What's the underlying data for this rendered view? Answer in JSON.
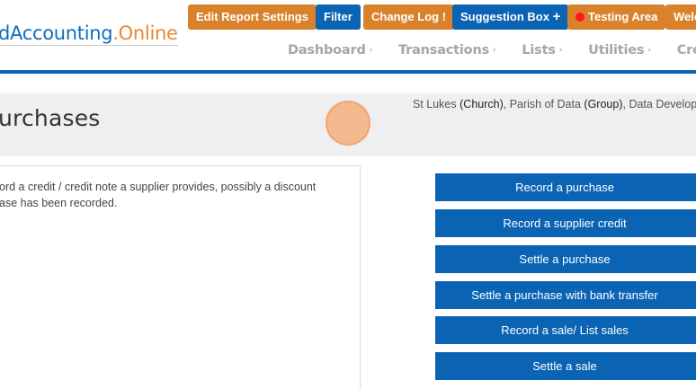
{
  "logo": {
    "part1": "d",
    "part2": "Accounting",
    "part3": ".Online"
  },
  "top_buttons": {
    "edit_report_settings": "Edit Report Settings",
    "filter": "Filter",
    "change_log": "Change Log",
    "change_log_badge": "!",
    "suggestion_box": "Suggestion Box",
    "suggestion_box_icon": "+",
    "testing_area": "Testing Area",
    "welcome": "Welc"
  },
  "nav": {
    "items": [
      {
        "label": "Dashboard"
      },
      {
        "label": "Transactions"
      },
      {
        "label": "Lists"
      },
      {
        "label": "Utilities"
      },
      {
        "label": "Create"
      }
    ],
    "caret": "›"
  },
  "header": {
    "title": "urchases",
    "context": {
      "org1": "St Lukes",
      "org1_type": "(Church)",
      "sep1": ", ",
      "org2": "Parish of Data",
      "org2_type": "(Group)",
      "sep2": ", ",
      "org3": "Data Develop"
    }
  },
  "description": {
    "line1": "ord a credit / credit note a supplier provides, possibly a discount",
    "line2": "ase has been recorded."
  },
  "actions": [
    {
      "label": "Record a purchase"
    },
    {
      "label": "Record a supplier credit"
    },
    {
      "label": "Settle a purchase"
    },
    {
      "label": "Settle a purchase with bank transfer"
    },
    {
      "label": "Record a sale/ List sales"
    },
    {
      "label": "Settle a sale"
    }
  ],
  "colors": {
    "brand_blue": "#0b63b3",
    "brand_orange": "#d9822b",
    "accent_orange": "#e98733"
  }
}
